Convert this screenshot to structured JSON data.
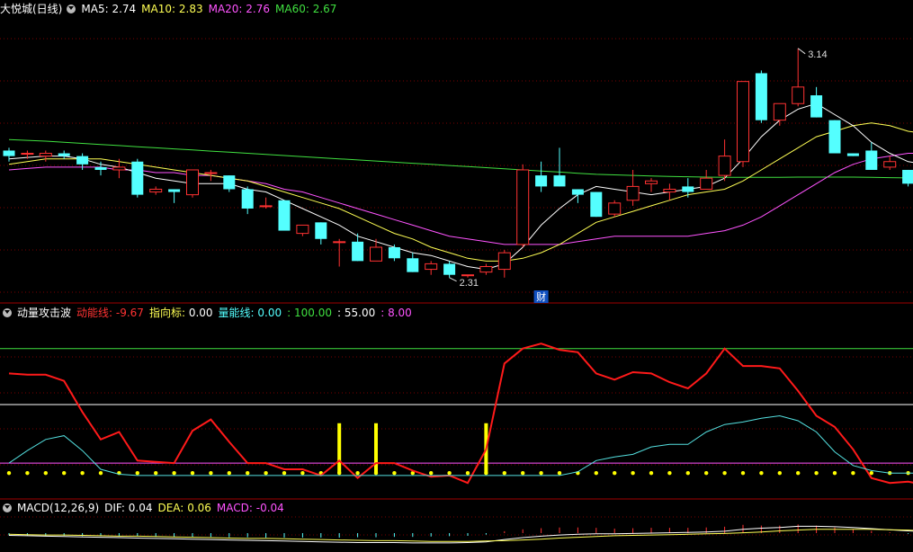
{
  "colors": {
    "up": "#ff3232",
    "down": "#54ffff",
    "ma5": "#ffffff",
    "ma10": "#ffff54",
    "ma20": "#ff54ff",
    "ma60": "#40e040"
  },
  "main_header": {
    "title": "大悦城(日线)",
    "ma5_label": "MA5:",
    "ma5_value": "2.74",
    "ma10_label": "MA10:",
    "ma10_value": "2.83",
    "ma20_label": "MA20:",
    "ma20_value": "2.76",
    "ma60_label": "MA60:",
    "ma60_value": "2.67",
    "dropdown_icon": "chevron-down-icon"
  },
  "price_annotations": {
    "high_label": "3.14",
    "low_label": "2.31",
    "cai_badge": "财"
  },
  "ind_header": {
    "title": "动量攻击波",
    "dnx_label": "动能线:",
    "dnx_value": "-9.67",
    "zxb_label": "指向标:",
    "zxb_value": "0.00",
    "lnx_label": "量能线:",
    "lnx_value": "0.00",
    "v100": ": 100.00",
    "v55": ": 55.00",
    "v8": ": 8.00"
  },
  "macd_header": {
    "title": "MACD(12,26,9)",
    "dif_label": "DIF:",
    "dif_value": "0.04",
    "dea_label": "DEA:",
    "dea_value": "0.06",
    "macd_label": "MACD:",
    "macd_value": "-0.04"
  },
  "chart_data": [
    {
      "type": "candlestick",
      "title": "大悦城(日线)",
      "ylim": [
        2.28,
        3.25
      ],
      "candles": [
        {
          "o": 2.77,
          "h": 2.78,
          "l": 2.73,
          "c": 2.75
        },
        {
          "o": 2.76,
          "h": 2.77,
          "l": 2.74,
          "c": 2.76
        },
        {
          "o": 2.75,
          "h": 2.77,
          "l": 2.73,
          "c": 2.76
        },
        {
          "o": 2.76,
          "h": 2.77,
          "l": 2.74,
          "c": 2.75
        },
        {
          "o": 2.75,
          "h": 2.76,
          "l": 2.7,
          "c": 2.72
        },
        {
          "o": 2.71,
          "h": 2.73,
          "l": 2.68,
          "c": 2.7
        },
        {
          "o": 2.7,
          "h": 2.74,
          "l": 2.67,
          "c": 2.71
        },
        {
          "o": 2.73,
          "h": 2.74,
          "l": 2.6,
          "c": 2.61
        },
        {
          "o": 2.62,
          "h": 2.64,
          "l": 2.61,
          "c": 2.63
        },
        {
          "o": 2.63,
          "h": 2.63,
          "l": 2.58,
          "c": 2.62
        },
        {
          "o": 2.61,
          "h": 2.7,
          "l": 2.6,
          "c": 2.7
        },
        {
          "o": 2.69,
          "h": 2.7,
          "l": 2.66,
          "c": 2.69
        },
        {
          "o": 2.68,
          "h": 2.68,
          "l": 2.62,
          "c": 2.63
        },
        {
          "o": 2.63,
          "h": 2.64,
          "l": 2.54,
          "c": 2.56
        },
        {
          "o": 2.57,
          "h": 2.6,
          "l": 2.56,
          "c": 2.57
        },
        {
          "o": 2.59,
          "h": 2.59,
          "l": 2.48,
          "c": 2.48
        },
        {
          "o": 2.47,
          "h": 2.5,
          "l": 2.46,
          "c": 2.5
        },
        {
          "o": 2.51,
          "h": 2.51,
          "l": 2.43,
          "c": 2.45
        },
        {
          "o": 2.44,
          "h": 2.45,
          "l": 2.35,
          "c": 2.44
        },
        {
          "o": 2.44,
          "h": 2.47,
          "l": 2.37,
          "c": 2.37
        },
        {
          "o": 2.37,
          "h": 2.45,
          "l": 2.37,
          "c": 2.42
        },
        {
          "o": 2.42,
          "h": 2.43,
          "l": 2.37,
          "c": 2.38
        },
        {
          "o": 2.38,
          "h": 2.4,
          "l": 2.33,
          "c": 2.33
        },
        {
          "o": 2.34,
          "h": 2.37,
          "l": 2.32,
          "c": 2.36
        },
        {
          "o": 2.36,
          "h": 2.37,
          "l": 2.31,
          "c": 2.32
        },
        {
          "o": 2.32,
          "h": 2.32,
          "l": 2.31,
          "c": 2.32
        },
        {
          "o": 2.33,
          "h": 2.36,
          "l": 2.32,
          "c": 2.35
        },
        {
          "o": 2.34,
          "h": 2.41,
          "l": 2.31,
          "c": 2.4
        },
        {
          "o": 2.43,
          "h": 2.72,
          "l": 2.42,
          "c": 2.7
        },
        {
          "o": 2.68,
          "h": 2.73,
          "l": 2.62,
          "c": 2.64
        },
        {
          "o": 2.68,
          "h": 2.78,
          "l": 2.64,
          "c": 2.64
        },
        {
          "o": 2.63,
          "h": 2.63,
          "l": 2.58,
          "c": 2.61
        },
        {
          "o": 2.62,
          "h": 2.62,
          "l": 2.53,
          "c": 2.53
        },
        {
          "o": 2.54,
          "h": 2.59,
          "l": 2.53,
          "c": 2.58
        },
        {
          "o": 2.59,
          "h": 2.7,
          "l": 2.57,
          "c": 2.64
        },
        {
          "o": 2.65,
          "h": 2.67,
          "l": 2.62,
          "c": 2.66
        },
        {
          "o": 2.62,
          "h": 2.65,
          "l": 2.59,
          "c": 2.63
        },
        {
          "o": 2.64,
          "h": 2.67,
          "l": 2.6,
          "c": 2.62
        },
        {
          "o": 2.63,
          "h": 2.7,
          "l": 2.63,
          "c": 2.67
        },
        {
          "o": 2.68,
          "h": 2.81,
          "l": 2.66,
          "c": 2.75
        },
        {
          "o": 2.73,
          "h": 3.02,
          "l": 2.71,
          "c": 3.02
        },
        {
          "o": 3.05,
          "h": 3.06,
          "l": 2.87,
          "c": 2.88
        },
        {
          "o": 2.88,
          "h": 2.94,
          "l": 2.86,
          "c": 2.94
        },
        {
          "o": 2.94,
          "h": 3.14,
          "l": 2.93,
          "c": 3.0
        },
        {
          "o": 2.97,
          "h": 3.0,
          "l": 2.89,
          "c": 2.89
        },
        {
          "o": 2.88,
          "h": 2.88,
          "l": 2.76,
          "c": 2.76
        },
        {
          "o": 2.76,
          "h": 2.76,
          "l": 2.75,
          "c": 2.75
        },
        {
          "o": 2.77,
          "h": 2.8,
          "l": 2.7,
          "c": 2.7
        },
        {
          "o": 2.71,
          "h": 2.75,
          "l": 2.7,
          "c": 2.73
        },
        {
          "o": 2.7,
          "h": 2.7,
          "l": 2.64,
          "c": 2.65
        },
        {
          "o": 2.65,
          "h": 2.7,
          "l": 2.64,
          "c": 2.66
        }
      ],
      "ma": {
        "MA5": [
          2.74,
          2.745,
          2.75,
          2.75,
          2.74,
          2.72,
          2.71,
          2.69,
          2.67,
          2.66,
          2.65,
          2.65,
          2.65,
          2.63,
          2.62,
          2.59,
          2.56,
          2.53,
          2.5,
          2.46,
          2.44,
          2.42,
          2.4,
          2.39,
          2.37,
          2.35,
          2.34,
          2.36,
          2.42,
          2.5,
          2.56,
          2.61,
          2.64,
          2.63,
          2.62,
          2.61,
          2.62,
          2.63,
          2.64,
          2.67,
          2.74,
          2.82,
          2.88,
          2.92,
          2.94,
          2.9,
          2.86,
          2.8,
          2.76,
          2.73,
          2.72
        ],
        "MA10": [
          2.72,
          2.73,
          2.74,
          2.74,
          2.74,
          2.74,
          2.73,
          2.72,
          2.71,
          2.7,
          2.69,
          2.68,
          2.67,
          2.66,
          2.64,
          2.62,
          2.6,
          2.58,
          2.56,
          2.53,
          2.5,
          2.47,
          2.45,
          2.42,
          2.4,
          2.38,
          2.37,
          2.37,
          2.38,
          2.4,
          2.43,
          2.47,
          2.51,
          2.53,
          2.55,
          2.57,
          2.59,
          2.61,
          2.62,
          2.63,
          2.66,
          2.7,
          2.74,
          2.78,
          2.82,
          2.84,
          2.86,
          2.87,
          2.86,
          2.84,
          2.83
        ],
        "MA20": [
          2.7,
          2.705,
          2.71,
          2.71,
          2.71,
          2.71,
          2.7,
          2.7,
          2.69,
          2.69,
          2.68,
          2.68,
          2.67,
          2.66,
          2.65,
          2.63,
          2.62,
          2.6,
          2.58,
          2.56,
          2.54,
          2.52,
          2.5,
          2.48,
          2.46,
          2.45,
          2.44,
          2.43,
          2.43,
          2.43,
          2.43,
          2.44,
          2.45,
          2.46,
          2.46,
          2.46,
          2.46,
          2.46,
          2.47,
          2.48,
          2.5,
          2.53,
          2.57,
          2.61,
          2.65,
          2.69,
          2.72,
          2.74,
          2.75,
          2.76,
          2.76
        ],
        "MA60": [
          2.81,
          2.807,
          2.804,
          2.8,
          2.796,
          2.792,
          2.788,
          2.784,
          2.78,
          2.776,
          2.772,
          2.768,
          2.764,
          2.76,
          2.756,
          2.752,
          2.748,
          2.744,
          2.74,
          2.736,
          2.732,
          2.728,
          2.724,
          2.72,
          2.716,
          2.712,
          2.708,
          2.704,
          2.7,
          2.696,
          2.692,
          2.688,
          2.684,
          2.682,
          2.68,
          2.678,
          2.676,
          2.675,
          2.674,
          2.673,
          2.673,
          2.673,
          2.673,
          2.674,
          2.674,
          2.674,
          2.674,
          2.673,
          2.672,
          2.671,
          2.67
        ]
      }
    },
    {
      "type": "line",
      "title": "动量攻击波",
      "ylim": [
        -10,
        120
      ],
      "series": [
        {
          "name": "动能线",
          "values": [
            80,
            79,
            79,
            74,
            49,
            27,
            33,
            10,
            9,
            8,
            34,
            43,
            25,
            8,
            8,
            3,
            3,
            -2,
            10,
            -4,
            8,
            8,
            2,
            -3,
            -2,
            -8,
            19,
            88,
            100,
            104,
            99,
            97,
            80,
            75,
            81,
            80,
            73,
            68,
            80,
            100,
            86,
            86,
            84,
            66,
            46,
            37,
            19,
            -4,
            -8,
            -7,
            -9.67
          ]
        },
        {
          "name": "量能线",
          "values": [
            8,
            18,
            27,
            30,
            18,
            3,
            -1,
            -2,
            -2,
            -2,
            -2,
            -2,
            -2,
            -2,
            -2,
            -2,
            -2,
            -2,
            -2,
            -2,
            -2,
            -2,
            -2,
            -2,
            -2,
            -2,
            -2,
            -2,
            -2,
            -2,
            -2,
            1,
            10,
            13,
            15,
            21,
            23,
            23,
            33,
            39,
            41,
            44,
            46,
            42,
            33,
            17,
            6,
            2,
            0,
            0,
            0
          ]
        }
      ],
      "signal_bars": [
        {
          "x": 18,
          "value": 40
        },
        {
          "x": 20,
          "value": 40
        },
        {
          "x": 26,
          "value": 40
        }
      ],
      "ref_lines": [
        100,
        55,
        8
      ]
    },
    {
      "type": "bar",
      "title": "MACD(12,26,9)",
      "ylim": [
        -0.5,
        0.5
      ],
      "macd": [
        -0.06,
        -0.06,
        -0.07,
        -0.07,
        -0.08,
        -0.08,
        -0.09,
        -0.09,
        -0.1,
        -0.1,
        -0.1,
        -0.1,
        -0.11,
        -0.11,
        -0.12,
        -0.12,
        -0.12,
        -0.12,
        -0.12,
        -0.11,
        -0.11,
        -0.1,
        -0.1,
        -0.09,
        -0.08,
        -0.07,
        -0.04,
        0.05,
        0.1,
        0.13,
        0.15,
        0.15,
        0.14,
        0.12,
        0.13,
        0.14,
        0.14,
        0.14,
        0.15,
        0.17,
        0.22,
        0.2,
        0.2,
        0.23,
        0.2,
        0.15,
        0.1,
        0.06,
        0.02,
        -0.02,
        -0.04
      ],
      "dif": [
        -0.06,
        -0.07,
        -0.08,
        -0.09,
        -0.1,
        -0.11,
        -0.12,
        -0.13,
        -0.14,
        -0.15,
        -0.16,
        -0.17,
        -0.18,
        -0.19,
        -0.2,
        -0.21,
        -0.22,
        -0.23,
        -0.24,
        -0.25,
        -0.25,
        -0.25,
        -0.26,
        -0.26,
        -0.26,
        -0.25,
        -0.23,
        -0.17,
        -0.12,
        -0.08,
        -0.05,
        -0.03,
        -0.02,
        -0.02,
        -0.01,
        0,
        0.01,
        0.02,
        0.03,
        0.05,
        0.1,
        0.13,
        0.15,
        0.18,
        0.18,
        0.17,
        0.15,
        0.12,
        0.09,
        0.06,
        0.04
      ],
      "dea": [
        -0.03,
        -0.04,
        -0.05,
        -0.05,
        -0.06,
        -0.07,
        -0.08,
        -0.08,
        -0.09,
        -0.1,
        -0.11,
        -0.12,
        -0.13,
        -0.14,
        -0.14,
        -0.15,
        -0.16,
        -0.17,
        -0.18,
        -0.19,
        -0.2,
        -0.2,
        -0.21,
        -0.22,
        -0.22,
        -0.22,
        -0.21,
        -0.2,
        -0.18,
        -0.16,
        -0.13,
        -0.11,
        -0.09,
        -0.07,
        -0.06,
        -0.05,
        -0.04,
        -0.03,
        -0.02,
        -0.01,
        0.01,
        0.03,
        0.06,
        0.08,
        0.1,
        0.1,
        0.1,
        0.1,
        0.09,
        0.08,
        0.06
      ]
    }
  ]
}
